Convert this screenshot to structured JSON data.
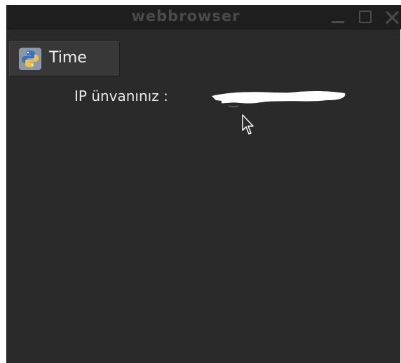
{
  "window": {
    "title": "webbrowser"
  },
  "toolbar": {
    "time_button_label": "Time",
    "time_button_icon": "python-icon"
  },
  "content": {
    "ip_label": "IP ünvanınız :"
  },
  "colors": {
    "window_bg": "#2a2a2a",
    "titlebar_bg": "#1e1e1e",
    "title_text": "#4a4a4a",
    "text": "#e8e8e8"
  }
}
